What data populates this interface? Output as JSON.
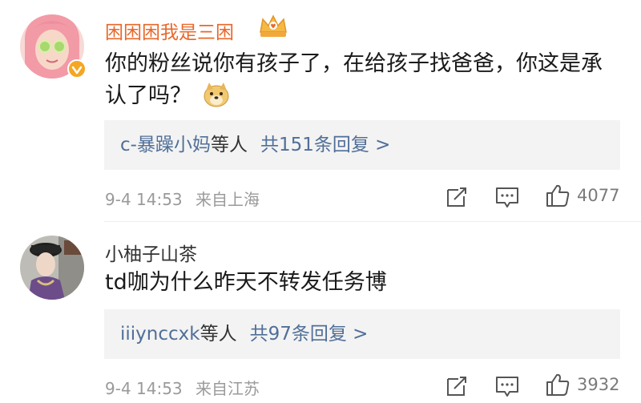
{
  "comments": [
    {
      "username": "困困困我是三困",
      "username_color": "#e8682a",
      "text": "你的粉丝说你有孩子了，在给孩子找爸爸，你这是承认了吗？",
      "emoji": "doge-emoji",
      "replies": {
        "users": "c-暴躁小妈",
        "etc": "等人",
        "count_label": "共151条回复 >"
      },
      "time": "9-4 14:53",
      "source": "来自上海",
      "likes": "4077"
    },
    {
      "username": "小柚子山茶",
      "username_color": "#333333",
      "text": "td咖为什么昨天不转发任务博",
      "replies": {
        "users": "iiiynccxk",
        "etc": "等人",
        "count_label": "共97条回复 >"
      },
      "time": "9-4 14:53",
      "source": "来自江苏",
      "likes": "3932"
    }
  ],
  "icons": {
    "repost": "repost-icon",
    "comment": "comment-icon",
    "like": "thumbs-up-icon",
    "crown": "crown-badge-icon",
    "vip": "verified-badge-icon"
  },
  "colors": {
    "link": "#506f98",
    "meta": "#9a9a9a",
    "reply_bg": "#f3f3f3",
    "badge": "#f5a623"
  }
}
